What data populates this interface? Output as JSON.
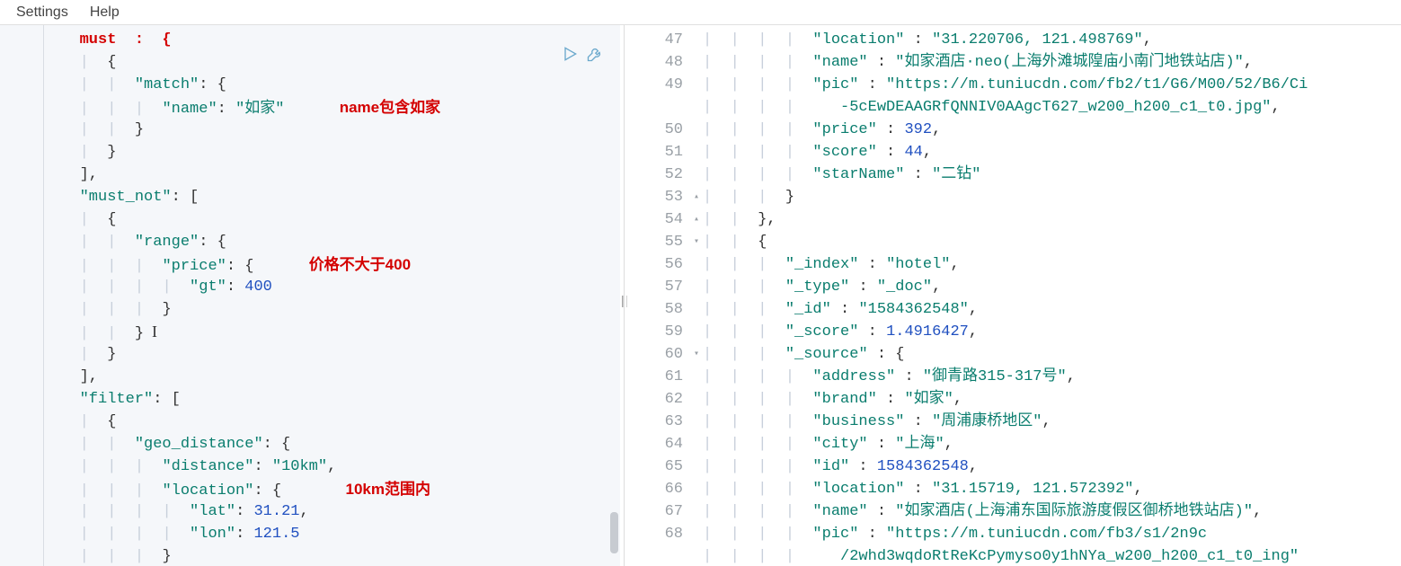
{
  "menubar": {
    "settings": "Settings",
    "help": "Help"
  },
  "annotations": {
    "name_contains": "name包含如家",
    "price_not_gt": "价格不大于400",
    "within_10km": "10km范围内"
  },
  "left_editor": {
    "lines": {
      "must_open": "must  :  {",
      "match_key": "\"match\"",
      "name_key": "\"name\"",
      "name_val": "\"如家\"",
      "must_not_key": "\"must_not\"",
      "range_key": "\"range\"",
      "price_key": "\"price\"",
      "gt_key": "\"gt\"",
      "gt_val": "400",
      "filter_key": "\"filter\"",
      "geo_key": "\"geo_distance\"",
      "distance_key": "\"distance\"",
      "distance_val": "\"10km\"",
      "location_key": "\"location\"",
      "lat_key": "\"lat\"",
      "lat_val": "31.21",
      "lon_key": "\"lon\"",
      "lon_val": "121.5"
    }
  },
  "right_editor": {
    "line_numbers": [
      "47",
      "48",
      "49",
      "",
      "50",
      "51",
      "52",
      "53",
      "54",
      "55",
      "56",
      "57",
      "58",
      "59",
      "60",
      "61",
      "62",
      "63",
      "64",
      "65",
      "66",
      "67",
      "68",
      ""
    ],
    "tokens": {
      "location47": "\"location\"",
      "location47v": "\"31.220706, 121.498769\"",
      "name48k": "\"name\"",
      "name48v": "\"如家酒店·neo(上海外滩城隍庙小南门地铁站店)\"",
      "pic49k": "\"pic\"",
      "pic49v": "\"https://m.tuniucdn.com/fb2/t1/G6/M00/52/B6/Ci",
      "pic49cont": "-5cEwDEAAGRfQNNIV0AAgcT627_w200_h200_c1_t0.jpg\"",
      "price50k": "\"price\"",
      "price50v": "392",
      "score51k": "\"score\"",
      "score51v": "44",
      "star52k": "\"starName\"",
      "star52v": "\"二钻\"",
      "index56k": "\"_index\"",
      "index56v": "\"hotel\"",
      "type57k": "\"_type\"",
      "type57v": "\"_doc\"",
      "id58k": "\"_id\"",
      "id58v": "\"1584362548\"",
      "score59k": "\"_score\"",
      "score59v": "1.4916427",
      "source60k": "\"_source\"",
      "addr61k": "\"address\"",
      "addr61v": "\"御青路315-317号\"",
      "brand62k": "\"brand\"",
      "brand62v": "\"如家\"",
      "biz63k": "\"business\"",
      "biz63v": "\"周浦康桥地区\"",
      "city64k": "\"city\"",
      "city64v": "\"上海\"",
      "id65k": "\"id\"",
      "id65v": "1584362548",
      "loc66k": "\"location\"",
      "loc66v": "\"31.15719, 121.572392\"",
      "name67k": "\"name\"",
      "name67v": "\"如家酒店(上海浦东国际旅游度假区御桥地铁站店)\"",
      "pic68k": "\"pic\"",
      "pic68v": "\"https://m.tuniucdn.com/fb3/s1/2n9c",
      "pic68cont": "/2whd3wqdoRtReKcPymyso0y1hNYa_w200_h200_c1_t0_ing\""
    }
  }
}
